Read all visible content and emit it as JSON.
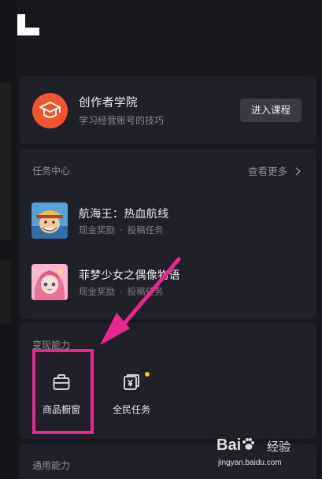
{
  "academy": {
    "title": "创作者学院",
    "subtitle": "学习经营账号的技巧",
    "button_label": "进入课程",
    "icon": "graduation-cap-icon",
    "icon_bg": "#f0552f"
  },
  "tasks": {
    "header": "任务中心",
    "see_more": "查看更多",
    "items": [
      {
        "title": "航海王：热血航线",
        "reward": "现金奖励",
        "separator": "·",
        "type": "投稿任务",
        "thumb": "anime-pirate-thumbnail"
      },
      {
        "title": "菲梦少女之偶像物语",
        "reward": "现金奖励",
        "separator": "·",
        "type": "投稿任务",
        "thumb": "anime-idol-girl-thumbnail"
      }
    ]
  },
  "monetize": {
    "header": "变现能力",
    "items": [
      {
        "label": "商品橱窗",
        "icon": "storefront-bag-icon"
      },
      {
        "label": "全民任务",
        "icon": "yuan-task-icon",
        "badge_color": "#f5c518"
      }
    ]
  },
  "general": {
    "header": "通用能力"
  },
  "annotation": {
    "color": "#e8278f"
  },
  "watermark": {
    "brand": "Bai",
    "suffix": "经验",
    "url": "jingyan.baidu.com"
  }
}
